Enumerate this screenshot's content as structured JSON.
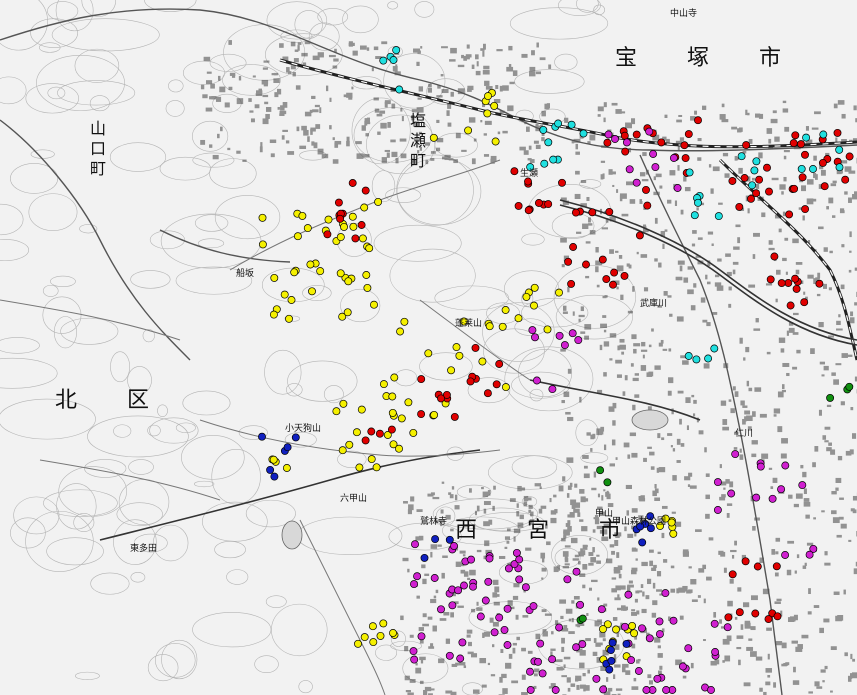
{
  "map": {
    "labels": {
      "takarazuka_city": "宝　塚　市",
      "nishinomiya_city": "西　宮　市",
      "kita_ward": "北　区",
      "shiose_town": "塩瀬町",
      "yamaguchi_town": "山口町",
      "funasaka": "船坂",
      "nakayama": "中山寺",
      "namaze": "生瀬",
      "kabutoyama": "甲山",
      "kokabuto": "小天狗山",
      "horai": "蓬莱山",
      "higashi_tarumi": "東多田",
      "ryugamine": "鷲林寺",
      "kitabata": "甲山森林公園",
      "jintsu": "仁川",
      "gorge": "武庫川",
      "roku": "六甲山"
    },
    "legend_colors": {
      "red": "#e00000",
      "yellow": "#f5f000",
      "magenta": "#d020d0",
      "cyan": "#20e0e0",
      "blue": "#1020c0",
      "green": "#109010"
    }
  }
}
